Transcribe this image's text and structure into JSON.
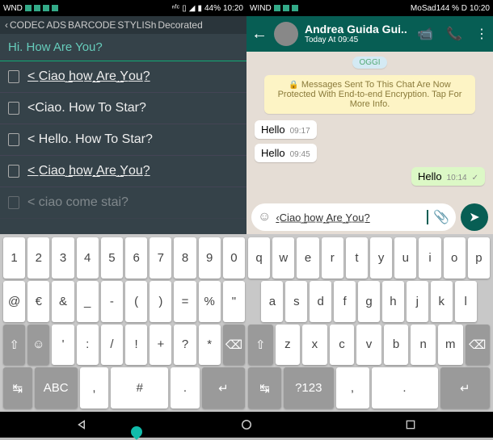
{
  "left": {
    "status": {
      "carrier": "WND",
      "battery": "44%",
      "time": "10:20"
    },
    "tabs": [
      "CODEC",
      "ADS",
      "BARCODE",
      "STYLISh",
      "Decorated"
    ],
    "input_text": "Hi. How Are You?",
    "items": [
      {
        "prefix": "「D",
        "text": "< C̲i̲a̲o̲ ̲h̲o̲w̲ ̲A̲r̲e̲ ̲Y̲o̲u̲?"
      },
      {
        "prefix": "「」",
        "text": "<Ciao. How To Star?"
      },
      {
        "prefix": "「Q",
        "text": "< Hello. How To Star?"
      },
      {
        "prefix": "「」",
        "text": "< C̲i̲a̲o̲ ̲h̲o̲w̲ ̲A̲r̲e̲ ̲Y̲o̲u̲?"
      },
      {
        "prefix": "「」",
        "text": "< ciao come stai?"
      }
    ]
  },
  "right": {
    "status": {
      "carrier": "WIND",
      "extra": "MoSad144 % D",
      "time": "10:20"
    },
    "header": {
      "name": "Andrea Guida Gui..",
      "sub": "Today At 09:45"
    },
    "date_badge": "OGGI",
    "encrypt_msg": "Messages Sent To This Chat Are Now Protected With End-to-end Encryption. Tap For More Info.",
    "messages": [
      {
        "dir": "in",
        "text": "Hello",
        "time": "09:17"
      },
      {
        "dir": "in",
        "text": "Hello",
        "time": "09:45"
      },
      {
        "dir": "out",
        "text": "Hello",
        "time": "10:14",
        "ticks": "✓"
      }
    ],
    "input_text": "‹C̲i̲a̲o̲ ̲h̲o̲w̲ ̲A̲r̲e̲ ̲Y̲o̲u̲?"
  },
  "keyboard": {
    "left_rows": [
      [
        "1",
        "2",
        "3",
        "4",
        "5",
        "6",
        "7",
        "8",
        "9",
        "0"
      ],
      [
        "@",
        "€",
        "&",
        "_",
        "-",
        "(",
        ")",
        "=",
        "%",
        "\""
      ],
      [
        "⇧",
        "☺",
        "'",
        ":",
        "/",
        "!",
        "+",
        "?",
        "*",
        "⌫"
      ],
      [
        "↹",
        "ABC",
        ",",
        "#",
        ".",
        "↵"
      ]
    ],
    "right_rows": [
      [
        "q",
        "w",
        "e",
        "r",
        "t",
        "y",
        "u",
        "i",
        "o",
        "p"
      ],
      [
        "a",
        "s",
        "d",
        "f",
        "g",
        "h",
        "j",
        "k",
        "l"
      ],
      [
        "⇧",
        "z",
        "x",
        "c",
        "v",
        "b",
        "n",
        "m",
        "⌫"
      ],
      [
        "↹",
        "?123",
        ",",
        ".",
        "↵"
      ]
    ]
  }
}
